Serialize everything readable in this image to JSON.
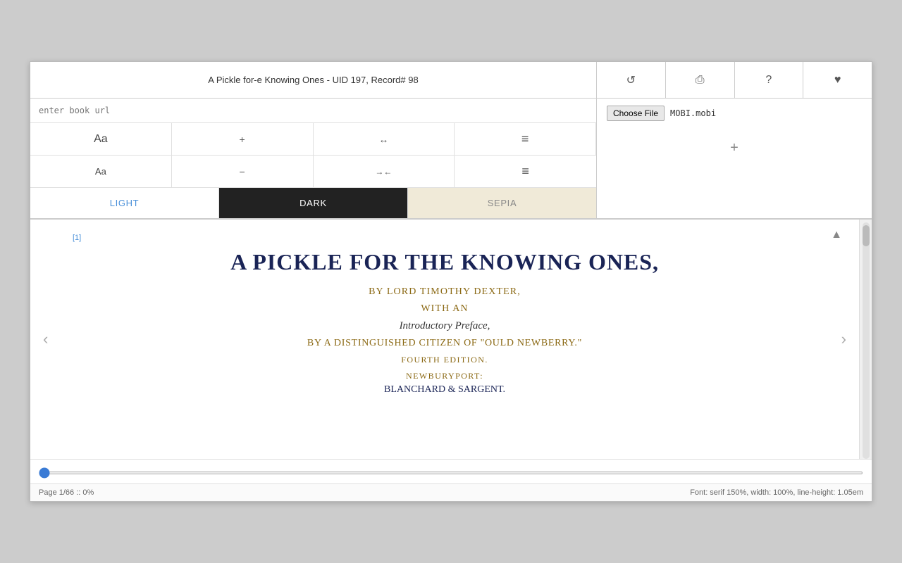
{
  "header": {
    "title": "A Pickle for-e Knowing Ones - UID 197, Record# 98"
  },
  "toolbar": {
    "refresh_icon": "↺",
    "print_icon": "⎙",
    "help_icon": "?",
    "heart_icon": "♥"
  },
  "url_input": {
    "placeholder": "enter book url",
    "value": ""
  },
  "font_controls": {
    "size_large_label": "Aa",
    "size_small_label": "Aa",
    "increase_label": "+",
    "decrease_label": "−",
    "width_increase_label": "↔",
    "width_decrease_label": "↔",
    "line_height_increase_label": "≡",
    "line_height_decrease_label": "≡"
  },
  "themes": {
    "light_label": "LIGHT",
    "dark_label": "DARK",
    "sepia_label": "SEPIA"
  },
  "file_input": {
    "button_label": "Choose File",
    "file_name": "MOBI.mobi"
  },
  "right_panel": {
    "add_icon": "+"
  },
  "reader": {
    "page_marker": "[1]",
    "scroll_top_icon": "▲",
    "prev_icon": "‹",
    "next_icon": "›",
    "book_title": "A PICKLE FOR THE KNOWING ONES,",
    "subtitle": "BY LORD TIMOTHY DEXTER,",
    "with_an": "WITH AN",
    "intro_preface": "Introductory Preface,",
    "by_citizen": "BY A DISTINGUISHED CITIZEN OF \"OULD NEWBERRY.\"",
    "edition": "FOURTH EDITION.",
    "city": "NEWBURYPORT:",
    "publisher": "BLANCHARD & SARGENT."
  },
  "status_bar": {
    "left": "Page 1/66 :: 0%",
    "right": "Font: serif 150%, width: 100%, line-height: 1.05em"
  },
  "progress": {
    "value": 0,
    "min": 0,
    "max": 100
  }
}
